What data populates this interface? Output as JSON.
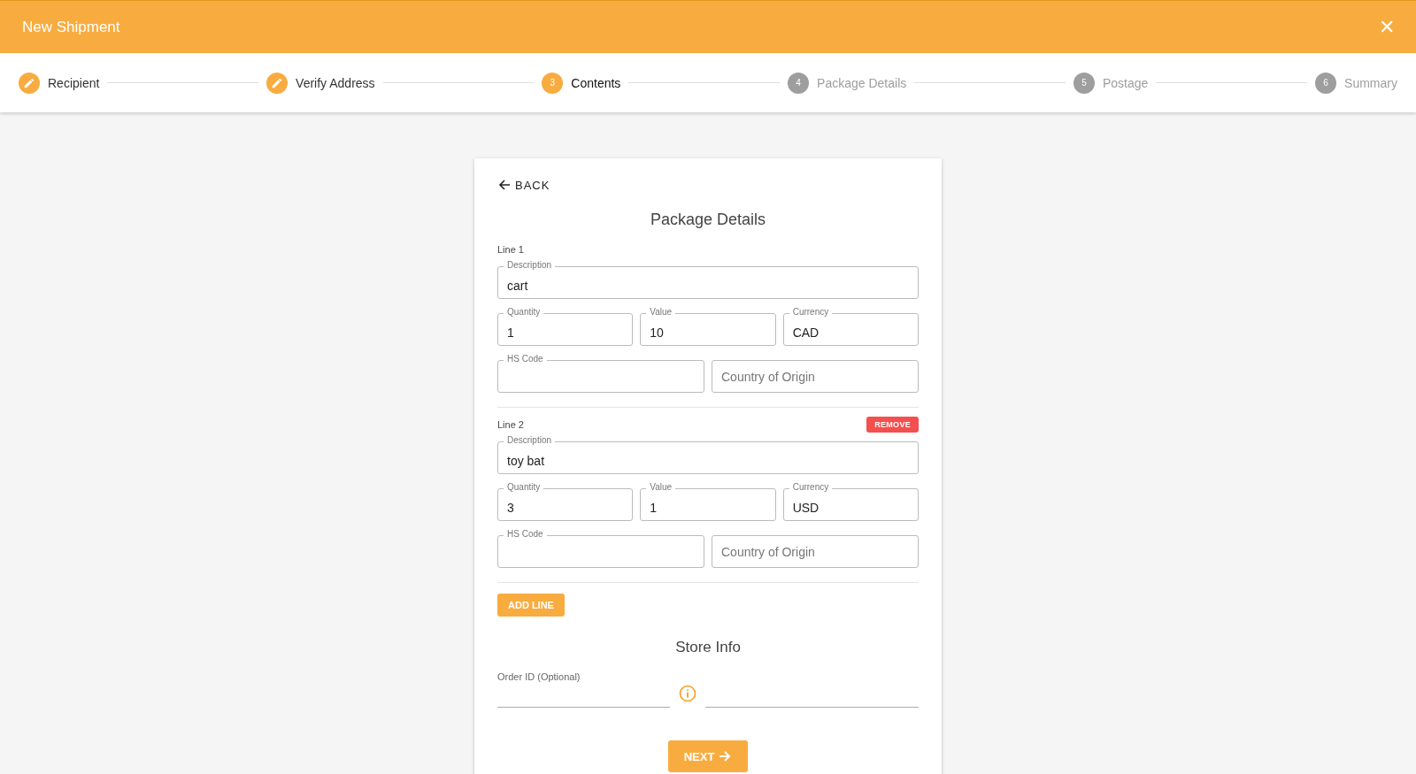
{
  "window": {
    "title": "New Shipment",
    "close_glyph": "✕"
  },
  "steps": [
    {
      "label": "Recipient",
      "kind": "done"
    },
    {
      "label": "Verify Address",
      "kind": "done"
    },
    {
      "number": "3",
      "label": "Contents",
      "kind": "active"
    },
    {
      "number": "4",
      "label": "Package Details",
      "kind": "upcoming"
    },
    {
      "number": "5",
      "label": "Postage",
      "kind": "upcoming"
    },
    {
      "number": "6",
      "label": "Summary",
      "kind": "upcoming"
    }
  ],
  "back_button": "BACK",
  "title": "Package Details",
  "lines": [
    {
      "label": "Line 1",
      "description": {
        "label": "Description",
        "value": "cart"
      },
      "quantity": {
        "label": "Quantity",
        "value": "1"
      },
      "value": {
        "label": "Value",
        "value": "10"
      },
      "currency": {
        "label": "Currency",
        "value": "CAD"
      },
      "hs_code": {
        "label": "HS Code"
      },
      "country_of_origin": {
        "placeholder": "Country of Origin"
      }
    },
    {
      "label": "Line 2",
      "remove_button": "REMOVE",
      "description": {
        "label": "Description",
        "value": "toy bat"
      },
      "quantity": {
        "label": "Quantity",
        "value": "3"
      },
      "value": {
        "label": "Value",
        "value": "1"
      },
      "currency": {
        "label": "Currency",
        "value": "USD"
      },
      "hs_code": {
        "label": "HS Code"
      },
      "country_of_origin": {
        "placeholder": "Country of Origin"
      }
    }
  ],
  "add_line_button": "ADD LINE",
  "store_info": {
    "title": "Store Info",
    "order_id": {
      "label": "Order ID (Optional)"
    }
  },
  "next_button": "NEXT"
}
